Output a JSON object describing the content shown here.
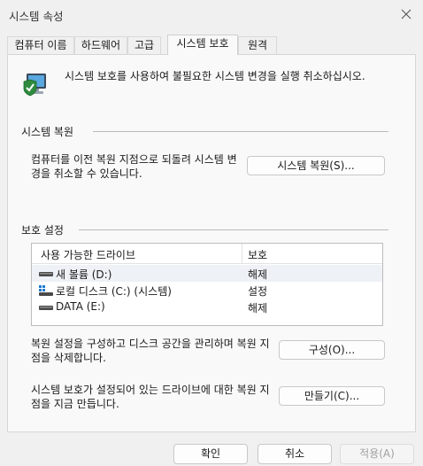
{
  "window": {
    "title": "시스템 속성"
  },
  "tabs": [
    {
      "label": "컴퓨터 이름"
    },
    {
      "label": "하드웨어"
    },
    {
      "label": "고급"
    },
    {
      "label": "시스템 보호"
    },
    {
      "label": "원격"
    }
  ],
  "header": {
    "text": "시스템 보호를 사용하여 불필요한 시스템 변경을 실행 취소하십시오.",
    "icon": "computer-shield-icon"
  },
  "restore": {
    "group_title": "시스템 복원",
    "description": "컴퓨터를 이전 복원 지점으로 되돌려 시스템 변경을 취소할 수 있습니다.",
    "button_label": "시스템 복원(S)..."
  },
  "protection": {
    "group_title": "보호 설정",
    "columns": {
      "drive": "사용 가능한 드라이브",
      "status": "보호"
    },
    "drives": [
      {
        "name": "새 볼륨 (D:)",
        "status": "해제",
        "icon": "hard-drive-icon",
        "selected": true
      },
      {
        "name": "로컬 디스크 (C:) (시스템)",
        "status": "설정",
        "icon": "system-drive-icon",
        "selected": false
      },
      {
        "name": "DATA (E:)",
        "status": "해제",
        "icon": "hard-drive-icon",
        "selected": false
      }
    ],
    "configure_desc": "복원 설정을 구성하고 디스크 공간을 관리하며 복원 지점을 삭제합니다.",
    "configure_button": "구성(O)...",
    "create_desc": "시스템 보호가 설정되어 있는 드라이브에 대한 복원 지점을 지금 만듭니다.",
    "create_button": "만들기(C)..."
  },
  "footer": {
    "ok": "확인",
    "cancel": "취소",
    "apply": "적용(A)"
  }
}
